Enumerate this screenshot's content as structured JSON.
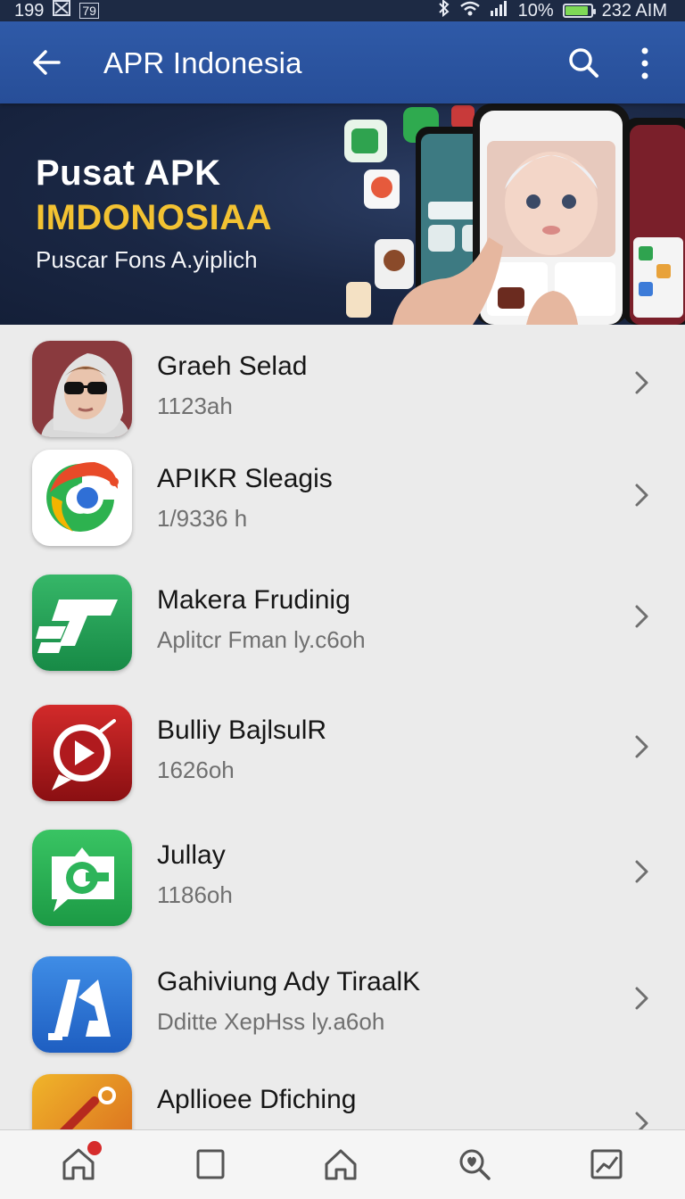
{
  "status_bar": {
    "left_text": "199",
    "left_box": "79",
    "battery": "10%",
    "time": "232 AIM",
    "battery_level": 0.9
  },
  "app_bar": {
    "title": "APR Indonesia"
  },
  "banner": {
    "title": "Pusat APK",
    "highlight": "IMDONOSIAA",
    "subtitle": "Puscar Fons A.yiplich"
  },
  "apps": [
    {
      "name": "Graeh Selad",
      "meta": "1123ah",
      "icon": "portrait-icon"
    },
    {
      "name": "APIKR Sleagis",
      "meta": "1/9336 h",
      "icon": "swirl-icon"
    },
    {
      "name": "Makera Frudinig",
      "meta": "Aplitcr Fman ly.c6oh",
      "icon": "stripes-icon"
    },
    {
      "name": "Bulliy BajlsulR",
      "meta": "1626oh",
      "icon": "play-chat-icon"
    },
    {
      "name": "Jullay",
      "meta": "1186oh",
      "icon": "chat-g-icon"
    },
    {
      "name": "Gahiviung Ady TiraalK",
      "meta": "Dditte XepHss ly.a6oh",
      "icon": "letter-a-icon"
    },
    {
      "name": "Apllioee Dfiching",
      "meta": "",
      "icon": "paint-icon"
    }
  ],
  "bottom_nav": {
    "items": [
      "home-icon",
      "square-icon",
      "house-icon",
      "search-heart-icon",
      "chart-icon"
    ],
    "badge": ""
  }
}
